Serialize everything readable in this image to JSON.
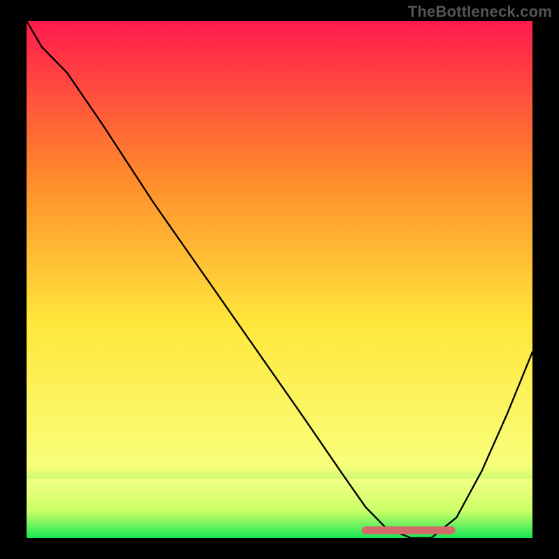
{
  "watermark": "TheBottleneck.com",
  "chart_data": {
    "type": "line",
    "title": "",
    "xlabel": "",
    "ylabel": "",
    "xlim": [
      0,
      100
    ],
    "ylim": [
      0,
      100
    ],
    "grid": false,
    "legend": false,
    "background_gradient": {
      "top": "#ff1a4d",
      "middle_top": "#ff8a2b",
      "middle": "#ffe63b",
      "lower": "#f8ff7a",
      "bottom": "#19e657"
    },
    "series": [
      {
        "name": "bottleneck-curve",
        "color": "#000000",
        "x": [
          0,
          3,
          8,
          15,
          25,
          35,
          45,
          55,
          62,
          67,
          71,
          76,
          80,
          85,
          90,
          95,
          100
        ],
        "y": [
          100,
          95,
          90,
          80,
          65,
          51,
          37,
          23,
          13,
          6,
          2,
          0,
          0,
          4,
          13,
          24,
          36
        ]
      },
      {
        "name": "optimal-zone",
        "color": "#d46a6a",
        "type": "segment",
        "x": [
          67,
          84
        ],
        "y": [
          1.5,
          1.5
        ]
      }
    ],
    "optimal_range": {
      "x_start": 67,
      "x_end": 84
    }
  }
}
